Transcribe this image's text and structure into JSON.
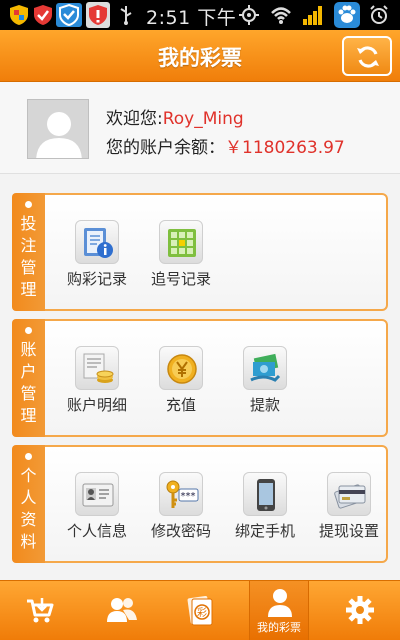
{
  "status_bar": {
    "time": "2:51 下午",
    "icons": [
      "shield-app-icon",
      "shield-check-icon",
      "antivirus-icon",
      "shield-alert-icon",
      "usb-icon",
      "gps-icon",
      "wifi-icon",
      "signal-icon",
      "paw-icon",
      "alarm-icon"
    ]
  },
  "header": {
    "title": "我的彩票",
    "refresh_icon": "refresh-icon"
  },
  "profile": {
    "welcome_label": "欢迎您:",
    "username": "Roy_Ming",
    "balance_label": "您的账户余额：",
    "balance_value": "￥1180263.97"
  },
  "sections": [
    {
      "title": "投注管理",
      "items": [
        {
          "label": "购彩记录",
          "icon": "notebook-info-icon"
        },
        {
          "label": "追号记录",
          "icon": "grid-icon"
        }
      ]
    },
    {
      "title": "账户管理",
      "items": [
        {
          "label": "账户明细",
          "icon": "ledger-coins-icon"
        },
        {
          "label": "充值",
          "icon": "yen-coin-icon"
        },
        {
          "label": "提款",
          "icon": "cash-withdraw-icon"
        }
      ]
    },
    {
      "title": "个人资料",
      "items": [
        {
          "label": "个人信息",
          "icon": "id-card-icon"
        },
        {
          "label": "修改密码",
          "icon": "key-password-icon"
        },
        {
          "label": "绑定手机",
          "icon": "smartphone-icon"
        },
        {
          "label": "提现设置",
          "icon": "bank-card-icon"
        }
      ]
    }
  ],
  "bottom_nav": {
    "items": [
      "cart-icon",
      "users-icon",
      "lottery-ticket-icon",
      "user-icon",
      "gear-icon"
    ],
    "active_label": "我的彩票"
  },
  "colors": {
    "accent": "#f28a1c",
    "balance": "#e0322b"
  }
}
